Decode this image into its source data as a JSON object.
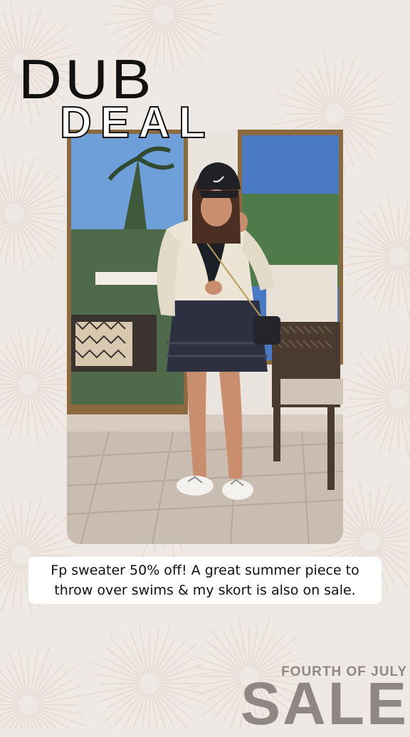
{
  "header": {
    "title_line1": "DUB",
    "title_line2": "DEAL"
  },
  "photo": {
    "description_icon": "outfit-photo",
    "accent_colors": {
      "sky": "#6f9fd8",
      "cap": "#1f2127",
      "sweater": "#ece4d4",
      "skort": "#2c3040",
      "wicker": "#4a3a30",
      "floor": "#c9bdb1"
    }
  },
  "caption": {
    "line1": "Fp sweater 50% off! A great summer piece to",
    "line2": "throw over swims & my skort is also on sale."
  },
  "footer": {
    "sale_subtitle": "FOURTH OF JULY",
    "sale_title": "SALE"
  },
  "colors": {
    "background": "#efe9e5",
    "burst": "#e4d6c8",
    "title": "#111111",
    "sale_text": "#8e8784"
  }
}
